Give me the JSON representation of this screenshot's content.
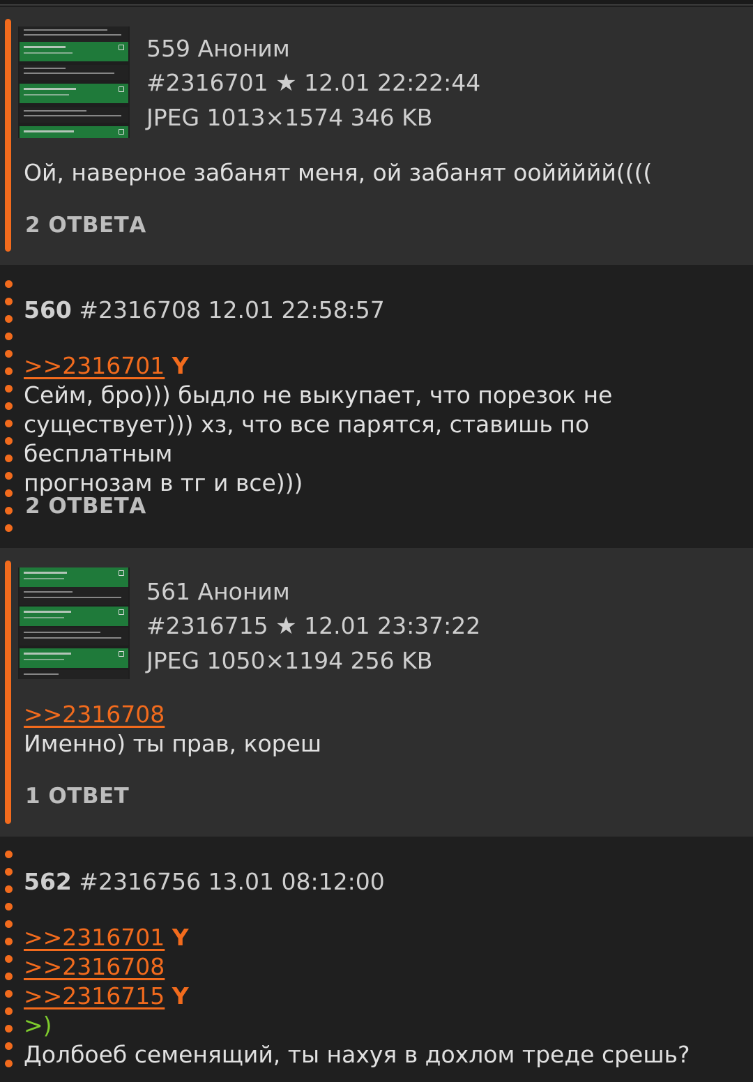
{
  "posts": [
    {
      "num": "559",
      "author": "Аноним",
      "id": "#2316701",
      "datetime": "12.01 22:22:44",
      "file": "JPEG 1013×1574 346 KB",
      "text": "Ой, наверное забанят меня, ой забанят ооййййй((((",
      "replies": "2 ОТВЕТА"
    },
    {
      "num": "560",
      "id": "#2316708",
      "datetime": "12.01 22:58:57",
      "ref": ">>2316701",
      "ref_you": "Y",
      "lines": [
        "Сейм, бро))) быдло не выкупает, что порезок не",
        "существует))) хз, что все парятся, ставишь по бесплатным",
        "прогнозам в тг и все)))"
      ],
      "replies": "2 ОТВЕТА"
    },
    {
      "num": "561",
      "author": "Аноним",
      "id": "#2316715",
      "datetime": "12.01 23:37:22",
      "file": "JPEG 1050×1194 256 KB",
      "ref": ">>2316708",
      "text": "Именно) ты прав, кореш",
      "replies": "1 ОТВЕТ"
    },
    {
      "num": "562",
      "id": "#2316756",
      "datetime": "13.01 08:12:00",
      "refs": [
        ">>2316701",
        ">>2316708",
        ">>2316715"
      ],
      "ref_you": "Y",
      "quote": ">)",
      "text": "Долбоеб семенящий, ты нахуя в дохлом треде срешь?"
    }
  ],
  "icons": {
    "star": "star-icon"
  },
  "colors": {
    "accent": "#f26b1d",
    "quote": "#7ecb2d"
  }
}
